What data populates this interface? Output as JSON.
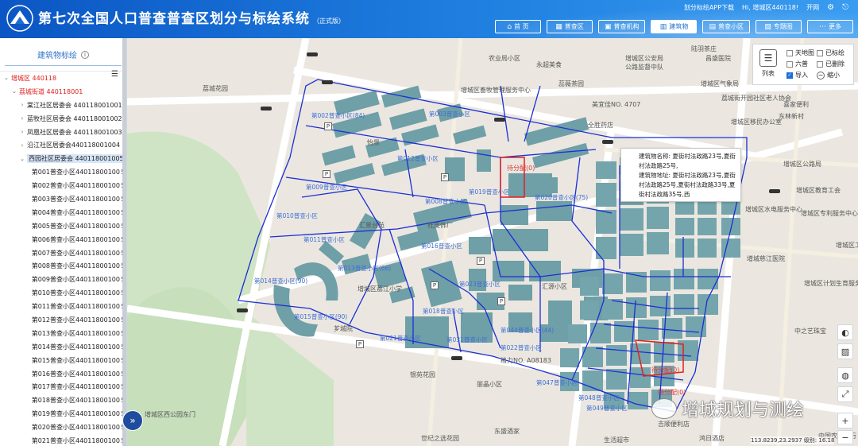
{
  "header": {
    "title": "第七次全国人口普查普查区划分与标绘系统",
    "title_badge": "（正式版）",
    "links": {
      "app_download": "划分标绘APP下载",
      "greeting": "Hi, 增城区440118!",
      "open": "开网"
    },
    "nav": [
      {
        "label": "首 页",
        "icon": "home-icon"
      },
      {
        "label": "普查区",
        "icon": "map-icon"
      },
      {
        "label": "普查机构",
        "icon": "org-icon"
      },
      {
        "label": "建筑物",
        "icon": "building-icon",
        "active": true
      },
      {
        "label": "普查小区",
        "icon": "grid-icon"
      },
      {
        "label": "专题图",
        "icon": "chart-icon"
      },
      {
        "label": "更多",
        "icon": "more-icon"
      }
    ]
  },
  "sidebar": {
    "title": "建筑物标绘",
    "tree": [
      {
        "label": "增城区 440118",
        "level": 0,
        "arrow": "v",
        "red": true
      },
      {
        "label": "荔城街道 440118001",
        "level": 1,
        "arrow": "v",
        "red": true
      },
      {
        "label": "棠江社区居委会 440118001001",
        "level": 2,
        "arrow": ">"
      },
      {
        "label": "蓝牧社区居委会 440118001002",
        "level": 2,
        "arrow": ">"
      },
      {
        "label": "凤凰社区居委会 440118001003",
        "level": 2,
        "arrow": ">"
      },
      {
        "label": "沿江社区居委会440118001004",
        "level": 2,
        "arrow": ">"
      },
      {
        "label": "西园社区居委会 440118001005",
        "level": 2,
        "arrow": "v",
        "selected": true
      },
      {
        "label": "第001普查小区44011800100５",
        "level": 3
      },
      {
        "label": "第002普查小区44011800100５",
        "level": 3
      },
      {
        "label": "第003普查小区44011800100５",
        "level": 3
      },
      {
        "label": "第004普查小区44011800100５",
        "level": 3
      },
      {
        "label": "第005普查小区44011800100５",
        "level": 3
      },
      {
        "label": "第006普查小区44011800100５",
        "level": 3
      },
      {
        "label": "第007普查小区44011800100５",
        "level": 3
      },
      {
        "label": "第008普查小区44011800100５",
        "level": 3
      },
      {
        "label": "第009普查小区44011800100５",
        "level": 3
      },
      {
        "label": "第010普查小区44011800100５",
        "level": 3
      },
      {
        "label": "第011普查小区44011800100５",
        "level": 3
      },
      {
        "label": "第012普查小区44011800100５",
        "level": 3
      },
      {
        "label": "第013普查小区44011800100５",
        "level": 3
      },
      {
        "label": "第014普查小区44011800100５",
        "level": 3
      },
      {
        "label": "第015普查小区44011800100５",
        "level": 3
      },
      {
        "label": "第016普查小区44011800100５",
        "level": 3
      },
      {
        "label": "第017普查小区44011800100５",
        "level": 3
      },
      {
        "label": "第018普查小区44011800100５",
        "level": 3
      },
      {
        "label": "第019普查小区44011800100５",
        "level": 3
      },
      {
        "label": "第020普查小区44011800100５",
        "level": 3
      },
      {
        "label": "第021普查小区44011800100５",
        "level": 3
      }
    ]
  },
  "map": {
    "poi_labels": [
      "陆羽茶庄",
      "农业局小区",
      "永超美食",
      "增城区公安局",
      "公路监督中队",
      "昌盛医院",
      "蕊薇茶园",
      "增城区畜牧管理服务中心",
      "增城区气象局",
      "美宜佳NO. 4707",
      "荔城街开园社区老人协会",
      "喜家便利",
      "荔城花园",
      "全胜药店",
      "东林新村",
      "增城区移民办公室",
      "怡景",
      "增城区公路局",
      "增城区教育工会",
      "增城区专利服务中心",
      "汇景台苑",
      "杜皮饰厂",
      "增城区水电服务中心",
      "增城区工业",
      "增城慈江医院",
      "增城区计划生育服务",
      "增城区荔江小学",
      "汇源小区",
      "中之艺珠宝",
      "格力NO. A08183",
      "银苑花园",
      "丽晶小区",
      "世纪之选花园",
      "东盛酒家",
      "鸿日酒店",
      "吉顺便利店",
      "中国农业银行",
      "生活超市",
      "增城区西公园东门",
      "芗城院"
    ],
    "zone_labels": [
      "第002普查小区(84)",
      "第003普查小区",
      "第008普查小区",
      "第009普查小区",
      "第010普查小区",
      "第011普查小区",
      "第012普查小区",
      "第013普查小区(66)",
      "第014普查小区(90)",
      "第015普查小区(90)",
      "第016普查小区",
      "第018普查小区",
      "第019普查小区",
      "第020普查小区(75)",
      "第021普查小区",
      "第022普查小区",
      "第023普查小区",
      "第031普查小区",
      "第044普查小区(44)",
      "第047普查小区",
      "第048普查小区",
      "第049普查小区"
    ],
    "red_labels": [
      "待分配(0)",
      "待分配(0)",
      "待分配(0)"
    ],
    "popup": {
      "name": "建筑物名称: 夏街村法政路23号,夏街村法政路25号,",
      "address": "建筑物地址: 夏街村法政路23号,夏街村法政路25号,夏街村法政路33号,夏街村法政路35号,西"
    },
    "tools": {
      "list_label": "列表",
      "checks": [
        {
          "label": "天地图",
          "on": false
        },
        {
          "label": "已标绘",
          "on": false
        },
        {
          "label": "六普",
          "on": false
        },
        {
          "label": "已删除",
          "on": false
        },
        {
          "label": "导入",
          "on": true
        }
      ],
      "shrink_label": "缩小"
    },
    "coords": "113.8239,23.2937  级别: 16.18",
    "watermark": "增城规划与测绘",
    "colors": {
      "building": "#6f9fa7",
      "boundary": "#1a2fd6",
      "green": "#cfe4c4",
      "road": "#ffffff",
      "accent": "#1e6fd8"
    }
  }
}
